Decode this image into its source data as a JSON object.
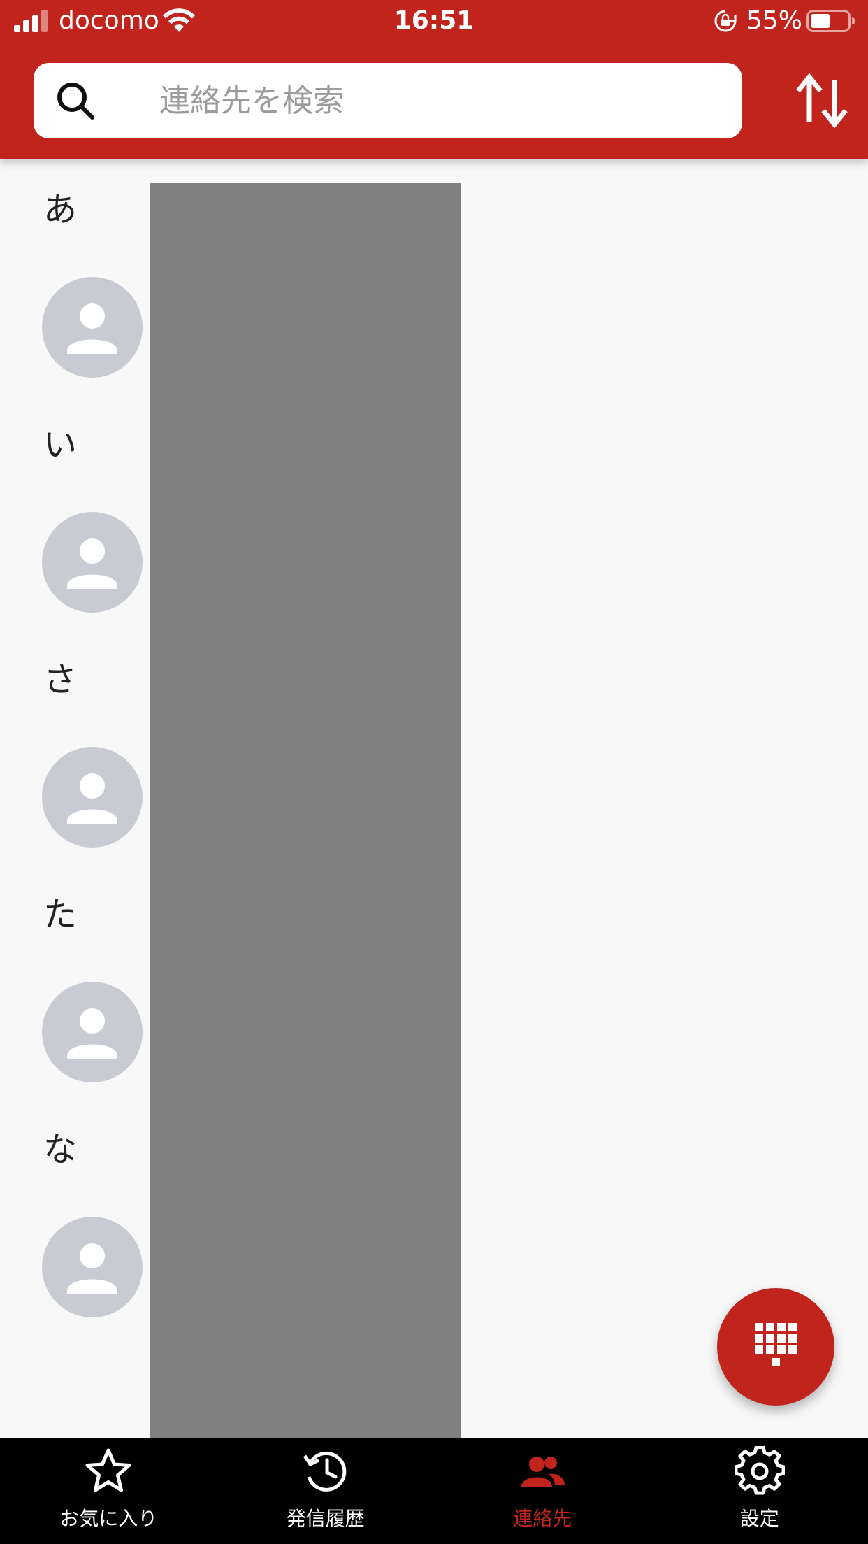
{
  "status_bar": {
    "carrier": "docomo",
    "time": "16:51",
    "battery_percent": "55%",
    "battery_level": 0.55
  },
  "search": {
    "placeholder": "連絡先を検索",
    "value": ""
  },
  "contacts": {
    "sections": [
      {
        "letter": "あ"
      },
      {
        "letter": "い"
      },
      {
        "letter": "さ"
      },
      {
        "letter": "た"
      },
      {
        "letter": "な"
      }
    ]
  },
  "bottom_nav": {
    "items": [
      {
        "label": "お気に入り",
        "icon": "star-icon",
        "active": false
      },
      {
        "label": "発信履歴",
        "icon": "history-icon",
        "active": false
      },
      {
        "label": "連絡先",
        "icon": "contacts-icon",
        "active": true
      },
      {
        "label": "設定",
        "icon": "gear-icon",
        "active": false
      }
    ]
  },
  "colors": {
    "brand_red": "#c0241d",
    "avatar_gray": "#c8cbd2",
    "nav_background": "#000000",
    "list_background": "#f8f8f8"
  }
}
